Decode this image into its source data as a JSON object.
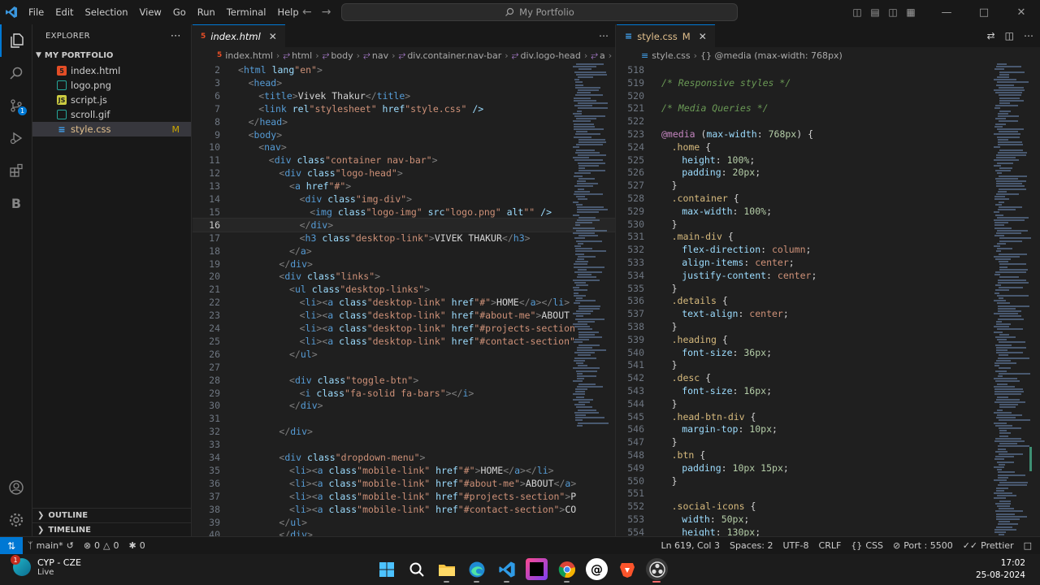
{
  "titlebar": {
    "menus": [
      "File",
      "Edit",
      "Selection",
      "View",
      "Go",
      "Run",
      "Terminal",
      "Help"
    ],
    "search_text": "My Portfolio"
  },
  "explorer": {
    "header": "EXPLORER",
    "folder": "MY PORTFOLIO",
    "files": [
      {
        "name": "index.html",
        "icon": "html-file-icon",
        "color": "#e44d26"
      },
      {
        "name": "logo.png",
        "icon": "image-file-icon",
        "color": "#26a69a"
      },
      {
        "name": "script.js",
        "icon": "js-file-icon",
        "color": "#cbcb41"
      },
      {
        "name": "scroll.gif",
        "icon": "image-file-icon",
        "color": "#26a69a"
      },
      {
        "name": "style.css",
        "icon": "css-file-icon",
        "color": "#42a5f5",
        "badge": "M"
      }
    ],
    "outline": "OUTLINE",
    "timeline": "TIMELINE",
    "scm_badge": "1"
  },
  "left_editor": {
    "tab": {
      "label": "index.html"
    },
    "breadcrumbs": [
      "index.html",
      "html",
      "body",
      "nav",
      "div.container.nav-bar",
      "div.logo-head",
      "a",
      "..."
    ],
    "current_line": "16",
    "lines": [
      {
        "n": "2",
        "indent": 0,
        "code": "<html lang=\"en\">"
      },
      {
        "n": "3",
        "indent": 1,
        "code": "<head>"
      },
      {
        "n": "6",
        "indent": 2,
        "code": "<title>Vivek Thakur</title>"
      },
      {
        "n": "7",
        "indent": 2,
        "code": "<link rel=\"stylesheet\" href=\"style.css\" />"
      },
      {
        "n": "8",
        "indent": 1,
        "code": "</head>"
      },
      {
        "n": "9",
        "indent": 1,
        "code": "<body>"
      },
      {
        "n": "10",
        "indent": 2,
        "code": "<nav>"
      },
      {
        "n": "11",
        "indent": 3,
        "code": "<div class=\"container nav-bar\">"
      },
      {
        "n": "12",
        "indent": 4,
        "code": "<div class=\"logo-head\">"
      },
      {
        "n": "13",
        "indent": 5,
        "code": "<a href=\"#\">"
      },
      {
        "n": "14",
        "indent": 6,
        "code": "<div class=\"img-div\">"
      },
      {
        "n": "15",
        "indent": 7,
        "code": "<img class=\"logo-img\" src=\"logo.png\" alt=\"\" />"
      },
      {
        "n": "16",
        "indent": 6,
        "code": "</div>"
      },
      {
        "n": "17",
        "indent": 6,
        "code": "<h3 class=\"desktop-link\">VIVEK THAKUR</h3>"
      },
      {
        "n": "18",
        "indent": 5,
        "code": "</a>"
      },
      {
        "n": "19",
        "indent": 4,
        "code": "</div>"
      },
      {
        "n": "20",
        "indent": 4,
        "code": "<div class=\"links\">"
      },
      {
        "n": "21",
        "indent": 5,
        "code": "<ul class=\"desktop-links\">"
      },
      {
        "n": "22",
        "indent": 6,
        "code": "<li><a class=\"desktop-link\" href=\"#\">HOME</a></li>"
      },
      {
        "n": "23",
        "indent": 6,
        "code": "<li><a class=\"desktop-link\" href=\"#about-me\">ABOUT<"
      },
      {
        "n": "24",
        "indent": 6,
        "code": "<li><a class=\"desktop-link\" href=\"#projects-section"
      },
      {
        "n": "25",
        "indent": 6,
        "code": "<li><a class=\"desktop-link\" href=\"#contact-section\""
      },
      {
        "n": "26",
        "indent": 5,
        "code": "</ul>"
      },
      {
        "n": "27",
        "indent": 0,
        "code": ""
      },
      {
        "n": "28",
        "indent": 5,
        "code": "<div class=\"toggle-btn\">"
      },
      {
        "n": "29",
        "indent": 6,
        "code": "<i class=\"fa-solid fa-bars\"></i>"
      },
      {
        "n": "30",
        "indent": 5,
        "code": "</div>"
      },
      {
        "n": "31",
        "indent": 0,
        "code": ""
      },
      {
        "n": "32",
        "indent": 4,
        "code": "</div>"
      },
      {
        "n": "33",
        "indent": 0,
        "code": ""
      },
      {
        "n": "34",
        "indent": 4,
        "code": "<div class=\"dropdown-menu\">"
      },
      {
        "n": "35",
        "indent": 5,
        "code": "<li><a class=\"mobile-link\" href=\"#\">HOME</a></li>"
      },
      {
        "n": "36",
        "indent": 5,
        "code": "<li><a class=\"mobile-link\" href=\"#about-me\">ABOUT</a>"
      },
      {
        "n": "37",
        "indent": 5,
        "code": "<li><a class=\"mobile-link\" href=\"#projects-section\">P"
      },
      {
        "n": "38",
        "indent": 5,
        "code": "<li><a class=\"mobile-link\" href=\"#contact-section\">CO"
      },
      {
        "n": "39",
        "indent": 4,
        "code": "</ul>"
      },
      {
        "n": "40",
        "indent": 4,
        "code": "</div>"
      }
    ]
  },
  "right_editor": {
    "tab": {
      "label": "style.css",
      "badge": "M"
    },
    "breadcrumbs": [
      "style.css",
      "{} @media (max-width: 768px)"
    ],
    "lines": [
      {
        "n": "518",
        "indent": 0,
        "code": ""
      },
      {
        "n": "519",
        "indent": 0,
        "code": "/* Responsive styles */"
      },
      {
        "n": "520",
        "indent": 0,
        "code": ""
      },
      {
        "n": "521",
        "indent": 0,
        "code": "/* Media Queries */"
      },
      {
        "n": "522",
        "indent": 0,
        "code": ""
      },
      {
        "n": "523",
        "indent": 0,
        "code": "@media (max-width: 768px) {"
      },
      {
        "n": "524",
        "indent": 1,
        "code": ".home {"
      },
      {
        "n": "525",
        "indent": 2,
        "code": "height: 100%;"
      },
      {
        "n": "526",
        "indent": 2,
        "code": "padding: 20px;"
      },
      {
        "n": "527",
        "indent": 1,
        "code": "}"
      },
      {
        "n": "528",
        "indent": 1,
        "code": ".container {"
      },
      {
        "n": "529",
        "indent": 2,
        "code": "max-width: 100%;"
      },
      {
        "n": "530",
        "indent": 1,
        "code": "}"
      },
      {
        "n": "531",
        "indent": 1,
        "code": ".main-div {"
      },
      {
        "n": "532",
        "indent": 2,
        "code": "flex-direction: column;"
      },
      {
        "n": "533",
        "indent": 2,
        "code": "align-items: center;"
      },
      {
        "n": "534",
        "indent": 2,
        "code": "justify-content: center;"
      },
      {
        "n": "535",
        "indent": 1,
        "code": "}"
      },
      {
        "n": "536",
        "indent": 1,
        "code": ".details {"
      },
      {
        "n": "537",
        "indent": 2,
        "code": "text-align: center;"
      },
      {
        "n": "538",
        "indent": 1,
        "code": "}"
      },
      {
        "n": "539",
        "indent": 1,
        "code": ".heading {"
      },
      {
        "n": "540",
        "indent": 2,
        "code": "font-size: 36px;"
      },
      {
        "n": "541",
        "indent": 1,
        "code": "}"
      },
      {
        "n": "542",
        "indent": 1,
        "code": ".desc {"
      },
      {
        "n": "543",
        "indent": 2,
        "code": "font-size: 16px;"
      },
      {
        "n": "544",
        "indent": 1,
        "code": "}"
      },
      {
        "n": "545",
        "indent": 1,
        "code": ".head-btn-div {"
      },
      {
        "n": "546",
        "indent": 2,
        "code": "margin-top: 10px;"
      },
      {
        "n": "547",
        "indent": 1,
        "code": "}"
      },
      {
        "n": "548",
        "indent": 1,
        "code": ".btn {"
      },
      {
        "n": "549",
        "indent": 2,
        "code": "padding: 10px 15px;"
      },
      {
        "n": "550",
        "indent": 1,
        "code": "}"
      },
      {
        "n": "551",
        "indent": 0,
        "code": ""
      },
      {
        "n": "552",
        "indent": 1,
        "code": ".social-icons {"
      },
      {
        "n": "553",
        "indent": 2,
        "code": "width: 50px;"
      },
      {
        "n": "554",
        "indent": 2,
        "code": "height: 130px;"
      }
    ]
  },
  "statusbar": {
    "branch": "main*",
    "errors": "0",
    "warnings": "0",
    "ports_count": "0",
    "cursor": "Ln 619, Col 3",
    "spaces": "Spaces: 2",
    "encoding": "UTF-8",
    "eol": "CRLF",
    "language": "CSS",
    "port": "Port : 5500",
    "formatter": "Prettier"
  },
  "taskbar": {
    "weather_title": "CYP - CZE",
    "weather_sub": "Live",
    "weather_badge": "1",
    "time": "17:02",
    "date": "25-08-2024"
  }
}
